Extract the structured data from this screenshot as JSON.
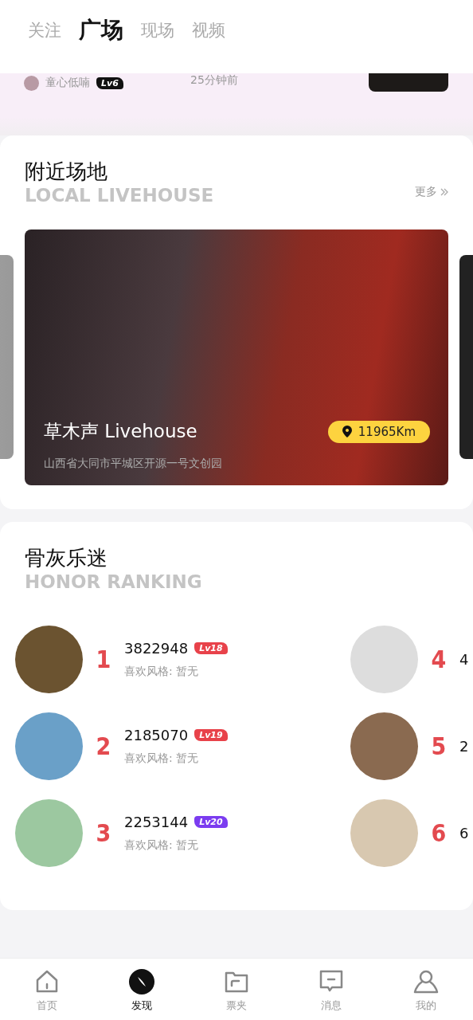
{
  "tabs": [
    {
      "label": "关注",
      "selected": false
    },
    {
      "label": "广场",
      "selected": true
    },
    {
      "label": "现场",
      "selected": false
    },
    {
      "label": "视频",
      "selected": false
    }
  ],
  "feed_post": {
    "author": "童心低喃",
    "level": "Lv6",
    "time": "25分钟前"
  },
  "nearby": {
    "title": "附近场地",
    "subtitle": "LOCAL LIVEHOUSE",
    "more": "更多",
    "venues": [
      {
        "name": "草木声 Livehouse",
        "distance": "11965Km",
        "address": "山西省大同市平城区开源一号文创园"
      }
    ]
  },
  "ranking": {
    "title": "骨灰乐迷",
    "subtitle": "HONOR RANKING",
    "items": [
      {
        "rank": "1",
        "name": "3822948",
        "level": "Lv18",
        "color": "#e8424a",
        "style": "喜欢风格: 暂无"
      },
      {
        "rank": "2",
        "name": "2185070",
        "level": "Lv19",
        "color": "#e8424a",
        "style": "喜欢风格: 暂无"
      },
      {
        "rank": "3",
        "name": "2253144",
        "level": "Lv20",
        "color": "#7b3cf0",
        "style": "喜欢风格: 暂无"
      },
      {
        "rank": "4",
        "name": "4"
      },
      {
        "rank": "5",
        "name": "2"
      },
      {
        "rank": "6",
        "name": "6"
      }
    ]
  },
  "nav": [
    {
      "label": "首页",
      "kind": "home",
      "selected": false
    },
    {
      "label": "发现",
      "kind": "discover",
      "selected": true
    },
    {
      "label": "票夹",
      "kind": "folder",
      "selected": false
    },
    {
      "label": "消息",
      "kind": "message",
      "selected": false
    },
    {
      "label": "我的",
      "kind": "user",
      "selected": false
    }
  ]
}
